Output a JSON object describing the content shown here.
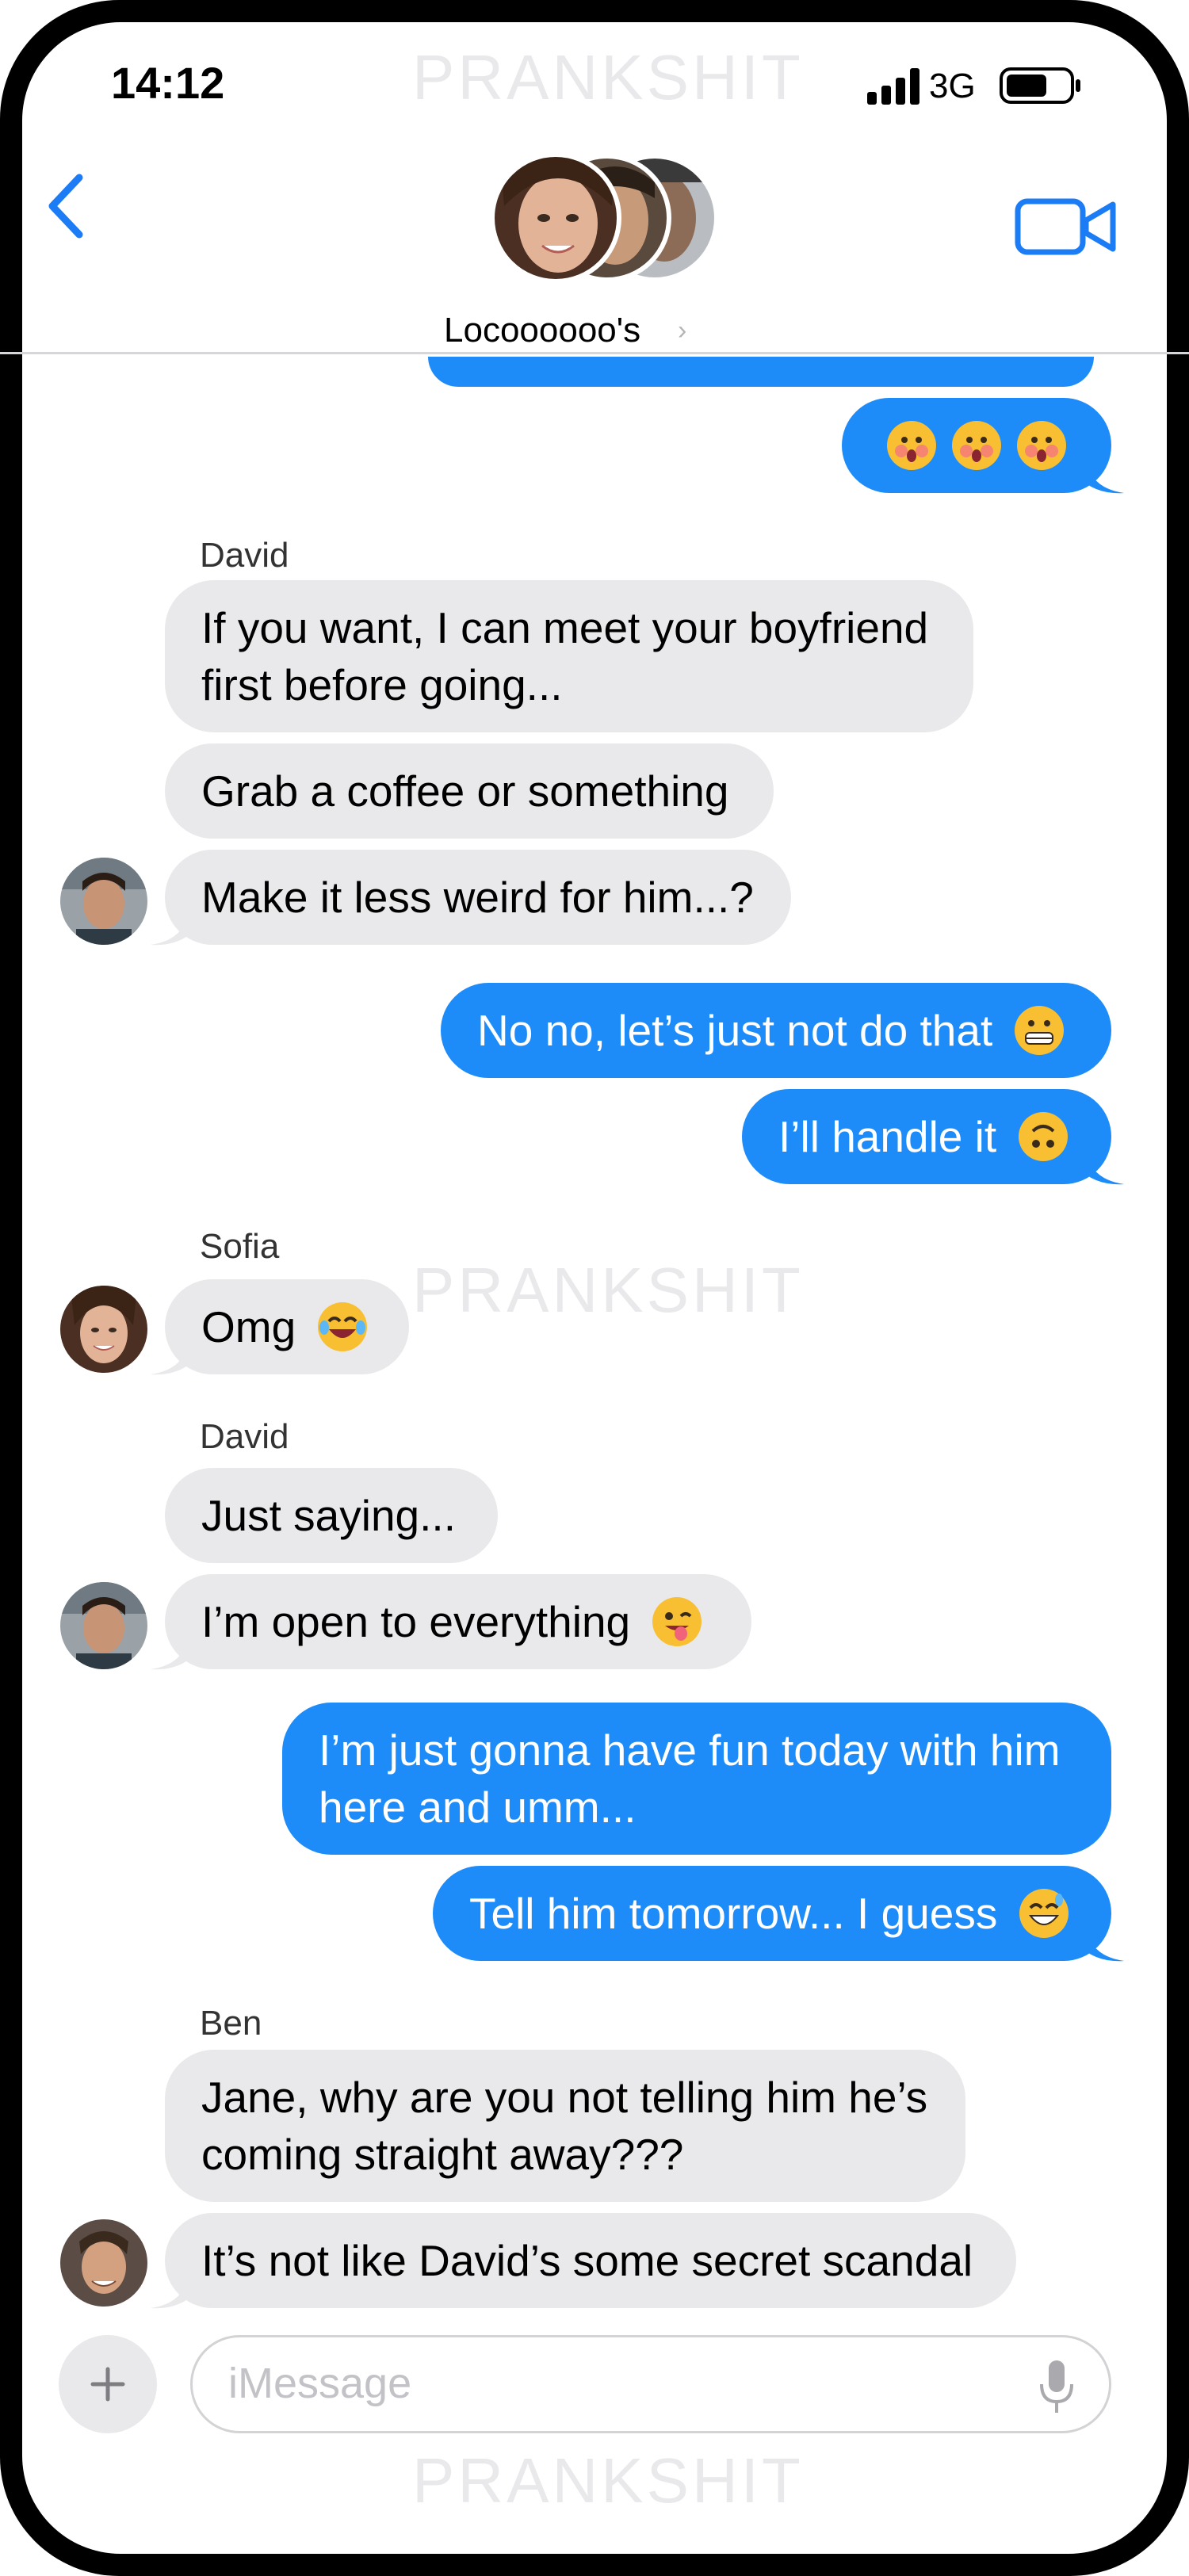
{
  "status_bar": {
    "time": "14:12",
    "network": "3G"
  },
  "watermark": "PRANKSHIT",
  "header": {
    "group_name": "Locoooooo's",
    "chevron": "›"
  },
  "messages": [
    {
      "type": "out",
      "text": "",
      "emoji": [
        "face-with-open-mouth-blushing",
        "face-with-open-mouth-blushing",
        "face-with-open-mouth-blushing"
      ]
    },
    {
      "sender": "David"
    },
    {
      "type": "in",
      "text": "If you want, I can meet your boyfriend first before going..."
    },
    {
      "type": "in",
      "text": "Grab a coffee or something"
    },
    {
      "type": "in",
      "text": "Make it less weird for him...?"
    },
    {
      "type": "out",
      "text": "No no, let’s just not do that",
      "emoji": "grimacing-face"
    },
    {
      "type": "out",
      "text": "I’ll handle it",
      "emoji": "upside-down-face"
    },
    {
      "sender": "Sofia"
    },
    {
      "type": "in",
      "text": "Omg",
      "emoji": "tears-of-joy-face"
    },
    {
      "sender": "David"
    },
    {
      "type": "in",
      "text": "Just saying..."
    },
    {
      "type": "in",
      "text": "I’m open to everything",
      "emoji": "winking-tongue-face"
    },
    {
      "type": "out",
      "text": "I’m just gonna have fun today with him here and umm..."
    },
    {
      "type": "out",
      "text": "Tell him tomorrow... I guess",
      "emoji": "grinning-sweat-face"
    },
    {
      "sender": "Ben"
    },
    {
      "type": "in",
      "text": "Jane, why are you not telling him he’s coming straight away???"
    },
    {
      "type": "in",
      "text": "It’s not like David’s some secret scandal"
    }
  ],
  "senders": {
    "david_1": "David",
    "sofia": "Sofia",
    "david_2": "David",
    "ben": "Ben"
  },
  "composer": {
    "placeholder": "iMessage"
  },
  "colors": {
    "outgoing": "#1e8cf8",
    "incoming": "#e9e9eb",
    "accent": "#1b7cf5"
  }
}
